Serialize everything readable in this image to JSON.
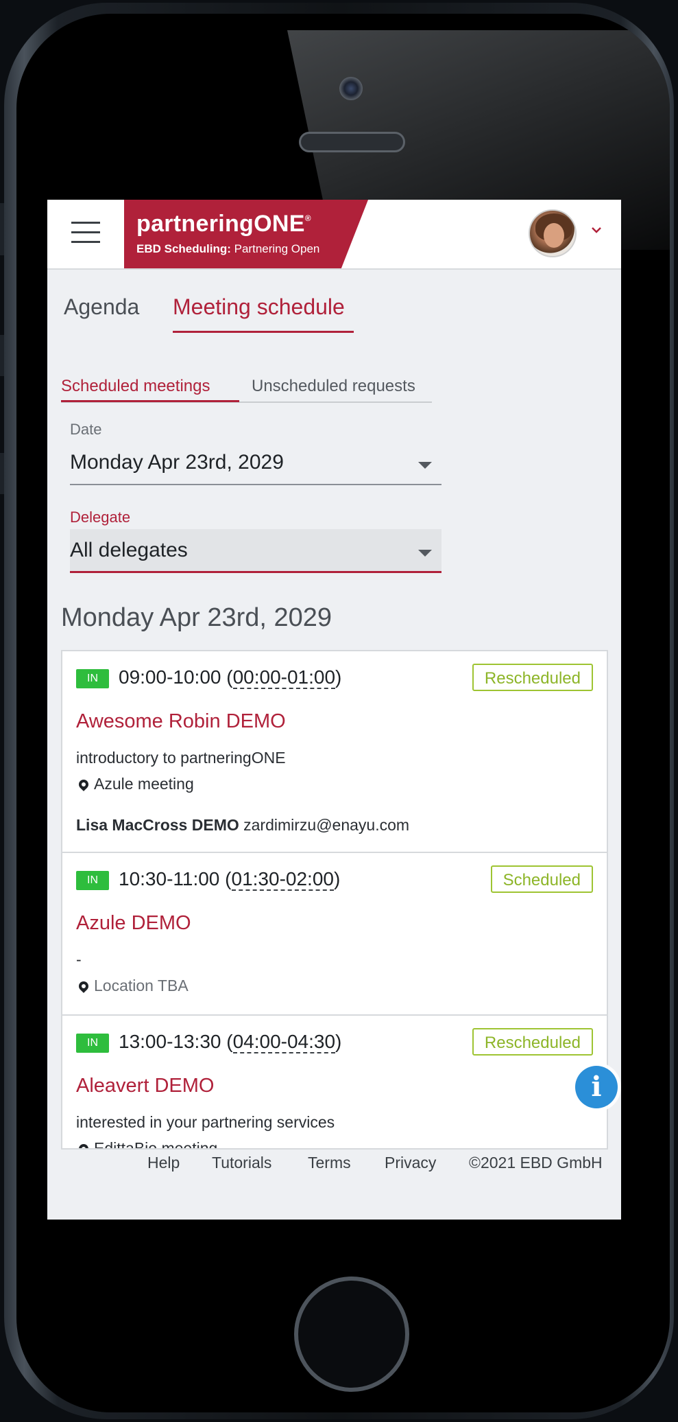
{
  "app": {
    "brand_name": "partneringONE",
    "brand_reg": "®",
    "brand_sub_bold": "EBD Scheduling:",
    "brand_sub_event": "Partnering Open",
    "user_menu_chevron": "⌄"
  },
  "main_tabs": [
    {
      "label": "Agenda",
      "active": false
    },
    {
      "label": "Meeting schedule",
      "active": true
    }
  ],
  "sub_tabs": [
    {
      "label": "Scheduled meetings",
      "active": true
    },
    {
      "label": "Unscheduled requests",
      "active": false
    }
  ],
  "filters": {
    "date_label": "Date",
    "date_value": "Monday Apr 23rd, 2029",
    "delegate_label": "Delegate",
    "delegate_value": "All delegates"
  },
  "day_heading": "Monday Apr 23rd, 2029",
  "meetings": [
    {
      "badge": "IN",
      "time_prefix": "09:00-10:00 (",
      "time_local": "00:00-01:00",
      "time_suffix": ")",
      "status": "Rescheduled",
      "company": "Awesome Robin DEMO",
      "description": "introductory to partneringONE",
      "location": "Azule meeting",
      "contact_name": "Lisa MacCross DEMO",
      "contact_email": "zardimirzu@enayu.com"
    },
    {
      "badge": "IN",
      "time_prefix": "10:30-11:00 (",
      "time_local": "01:30-02:00",
      "time_suffix": ")",
      "status": "Scheduled",
      "company": "Azule DEMO",
      "description": "-",
      "location": "Location TBA"
    },
    {
      "badge": "IN",
      "time_prefix": "13:00-13:30 (",
      "time_local": "04:00-04:30",
      "time_suffix": ")",
      "status": "Rescheduled",
      "company": "Aleavert DEMO",
      "description": "interested in your partnering services",
      "location": "EdittaBio meeting"
    }
  ],
  "info_button": "i",
  "footer": {
    "links": [
      "Help",
      "Tutorials",
      "Terms",
      "Privacy"
    ],
    "copyright": "©2021 EBD GmbH"
  },
  "colors": {
    "brand": "#b0213a",
    "status_green": "#9ec432",
    "in_badge": "#2ebd3d",
    "info": "#2b8fd8"
  }
}
